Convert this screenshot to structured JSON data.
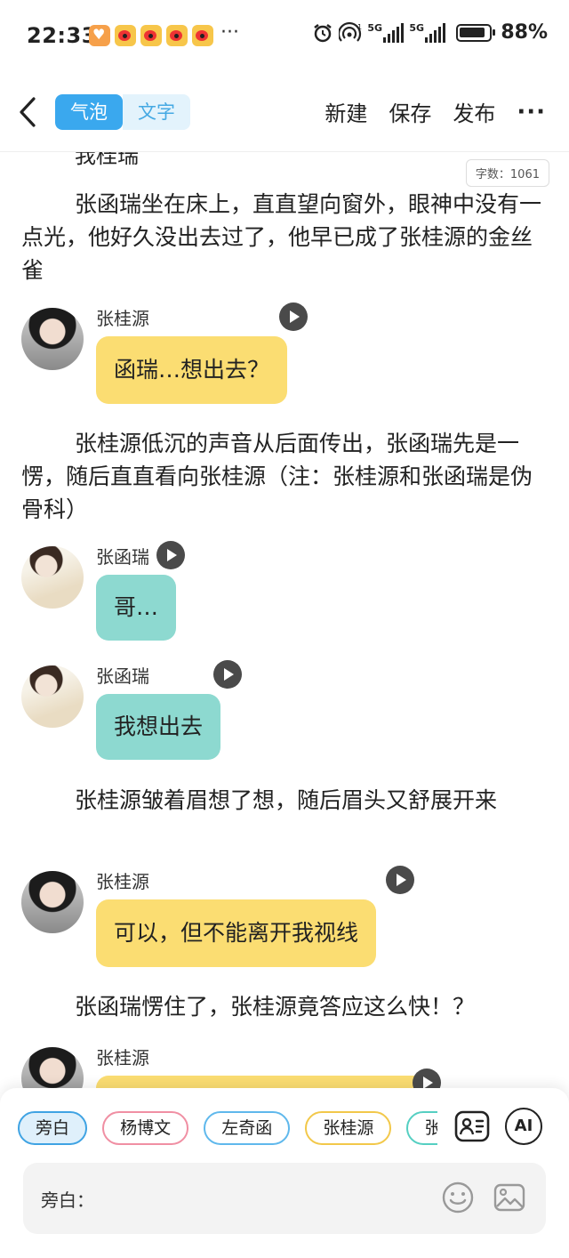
{
  "status_bar": {
    "time": "22:33",
    "more": "···",
    "signal1_label": "5G",
    "signal2_label": "5G",
    "battery": "88%"
  },
  "nav": {
    "tabs": [
      {
        "label": "气泡",
        "active": true
      },
      {
        "label": "文字",
        "active": false
      }
    ],
    "actions": {
      "new": "新建",
      "save": "保存",
      "publish": "发布"
    }
  },
  "editor": {
    "word_count": "字数：1061",
    "cut_off_line": "我桂瑞",
    "paragraphs": [
      "张函瑞坐在床上，直直望向窗外，眼神中没有一点光，他好久没出去过了，他早已成了张桂源的金丝雀",
      "张桂源低沉的声音从后面传出，张函瑞先是一愣，随后直直看向张桂源（注：张桂源和张函瑞是伪骨科）",
      "张桂源皱着眉想了想，随后眉头又舒展开来",
      "张函瑞愣住了，张桂源竟答应这么快！？"
    ],
    "messages": [
      {
        "speaker": "张桂源",
        "text": "函瑞…想出去？",
        "color": "#fbdd72"
      },
      {
        "speaker": "张函瑞",
        "text": "哥…",
        "color": "#8dd9d0"
      },
      {
        "speaker": "张函瑞",
        "text": "我想出去",
        "color": "#8dd9d0"
      },
      {
        "speaker": "张桂源",
        "text": "可以，但不能离开我视线",
        "color": "#fbdd72"
      },
      {
        "speaker": "张桂源",
        "text": "",
        "color": "#fbdd72"
      }
    ]
  },
  "composer": {
    "characters": [
      "旁白",
      "杨博文",
      "左奇函",
      "张桂源",
      "张函瑞"
    ],
    "selected": "旁白",
    "input_label": "旁白：",
    "ai_label": "AI"
  }
}
